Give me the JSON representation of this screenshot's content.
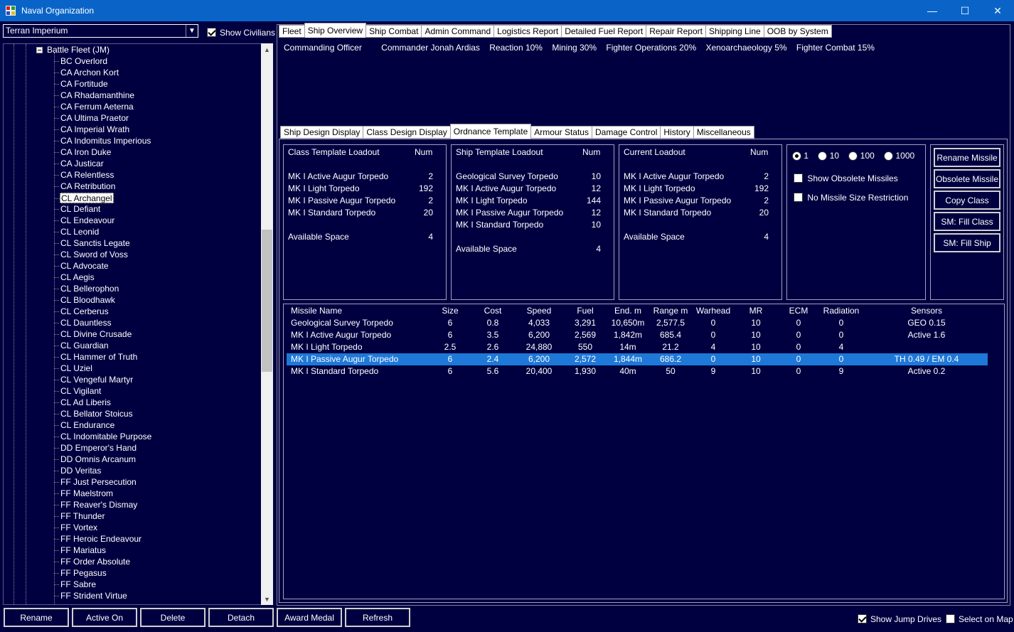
{
  "window": {
    "title": "Naval Organization",
    "minimize_glyph": "—",
    "maximize_glyph": "☐",
    "close_glyph": "✕"
  },
  "left": {
    "race_select": "Terran Imperium",
    "show_civilians_label": "Show Civilians",
    "show_civilians_checked": true,
    "fleet_name": "Battle Fleet  (JM)",
    "ships": [
      "BC Overlord",
      "CA Archon Kort",
      "CA Fortitude",
      "CA Rhadamanthine",
      "CA Ferrum Aeterna",
      "CA Ultima Praetor",
      "CA Imperial Wrath",
      "CA Indomitus Imperious",
      "CA Iron Duke",
      "CA Justicar",
      "CA Relentless",
      "CA Retribution",
      "CL Archangel",
      "CL Defiant",
      "CL Endeavour",
      "CL Leonid",
      "CL Sanctis Legate",
      "CL Sword of Voss",
      "CL Advocate",
      "CL Aegis",
      "CL Bellerophon",
      "CL Bloodhawk",
      "CL Cerberus",
      "CL Dauntless",
      "CL Divine Crusade",
      "CL Guardian",
      "CL Hammer of Truth",
      "CL Uziel",
      "CL Vengeful Martyr",
      "CL Vigilant",
      "CL Ad Liberis",
      "CL Bellator Stoicus",
      "CL Endurance",
      "CL Indomitable Purpose",
      "DD Emperor's Hand",
      "DD Omnis Arcanum",
      "DD Veritas",
      "FF Just Persecution",
      "FF Maelstrom",
      "FF Reaver's Dismay",
      "FF Thunder",
      "FF Vortex",
      "FF Heroic Endeavour",
      "FF Mariatus",
      "FF Order Absolute",
      "FF Pegasus",
      "FF Sabre",
      "FF Strident Virtue"
    ],
    "selected_ship": "CL Archangel"
  },
  "bottom": {
    "buttons": [
      "Rename",
      "Active On",
      "Delete",
      "Detach",
      "Award Medal",
      "Refresh"
    ],
    "show_jump_drives_label": "Show Jump Drives",
    "show_jump_drives_checked": true,
    "select_on_map_label": "Select on Map",
    "select_on_map_checked": false
  },
  "top_tabs": [
    "Fleet",
    "Ship Overview",
    "Ship Combat",
    "Admin Command",
    "Logistics Report",
    "Detailed Fuel Report",
    "Repair Report",
    "Shipping Line",
    "OOB by System"
  ],
  "top_tab_active": "Ship Overview",
  "commanding_officer": {
    "label": "Commanding Officer",
    "name": "Commander Jonah Ardias",
    "traits": [
      "Reaction 10%",
      "Mining 30%",
      "Fighter Operations 20%",
      "Xenoarchaeology 5%",
      "Fighter Combat 15%"
    ]
  },
  "sub_tabs": [
    "Ship Design Display",
    "Class Design Display",
    "Ordnance Template",
    "Armour Status",
    "Damage Control",
    "History",
    "Miscellaneous"
  ],
  "sub_tab_active": "Ordnance Template",
  "class_template": {
    "title": "Class Template Loadout",
    "num_header": "Num",
    "items": [
      {
        "name": "MK I Active Augur Torpedo",
        "num": "2"
      },
      {
        "name": "MK I Light Torpedo",
        "num": "192"
      },
      {
        "name": "MK I Passive Augur Torpedo",
        "num": "2"
      },
      {
        "name": "MK I Standard Torpedo",
        "num": "20"
      }
    ],
    "space_label": "Available Space",
    "space_value": "4"
  },
  "ship_template": {
    "title": "Ship Template Loadout",
    "num_header": "Num",
    "items": [
      {
        "name": "Geological Survey Torpedo",
        "num": "10"
      },
      {
        "name": "MK I Active Augur Torpedo",
        "num": "12"
      },
      {
        "name": "MK I Light Torpedo",
        "num": "144"
      },
      {
        "name": "MK I Passive Augur Torpedo",
        "num": "12"
      },
      {
        "name": "MK I Standard Torpedo",
        "num": "10"
      }
    ],
    "space_label": "Available Space",
    "space_value": "4"
  },
  "current_loadout": {
    "title": "Current Loadout",
    "num_header": "Num",
    "items": [
      {
        "name": "MK I Active Augur Torpedo",
        "num": "2"
      },
      {
        "name": "MK I Light Torpedo",
        "num": "192"
      },
      {
        "name": "MK I Passive Augur Torpedo",
        "num": "2"
      },
      {
        "name": "MK I Standard Torpedo",
        "num": "20"
      }
    ],
    "space_label": "Available Space",
    "space_value": "4"
  },
  "options": {
    "increments": [
      "1",
      "10",
      "100",
      "1000"
    ],
    "increment_selected": "1",
    "show_obsolete_label": "Show Obsolete Missiles",
    "no_size_restriction_label": "No Missile Size Restriction"
  },
  "action_buttons": [
    "Rename Missile",
    "Obsolete Missile",
    "Copy Class",
    "SM: Fill Class",
    "SM: Fill Ship"
  ],
  "missiles": {
    "headers": [
      "Missile Name",
      "Size",
      "Cost",
      "Speed",
      "Fuel",
      "End. m",
      "Range m",
      "Warhead",
      "MR",
      "ECM",
      "Radiation",
      "Sensors"
    ],
    "rows": [
      [
        "Geological Survey Torpedo",
        "6",
        "0.8",
        "4,033",
        "3,291",
        "10,650m",
        "2,577.5",
        "0",
        "10",
        "0",
        "0",
        "GEO 0.15"
      ],
      [
        "MK I Active Augur Torpedo",
        "6",
        "3.5",
        "6,200",
        "2,569",
        "1,842m",
        "685.4",
        "0",
        "10",
        "0",
        "0",
        "Active 1.6"
      ],
      [
        "MK I Light Torpedo",
        "2.5",
        "2.6",
        "24,880",
        "550",
        "14m",
        "21.2",
        "4",
        "10",
        "0",
        "4",
        ""
      ],
      [
        "MK I Passive Augur Torpedo",
        "6",
        "2.4",
        "6,200",
        "2,572",
        "1,844m",
        "686.2",
        "0",
        "10",
        "0",
        "0",
        "TH 0.49 /  EM 0.4"
      ],
      [
        "MK I Standard Torpedo",
        "6",
        "5.6",
        "20,400",
        "1,930",
        "40m",
        "50",
        "9",
        "10",
        "0",
        "9",
        "Active 0.2"
      ]
    ],
    "selected_row": 3
  }
}
